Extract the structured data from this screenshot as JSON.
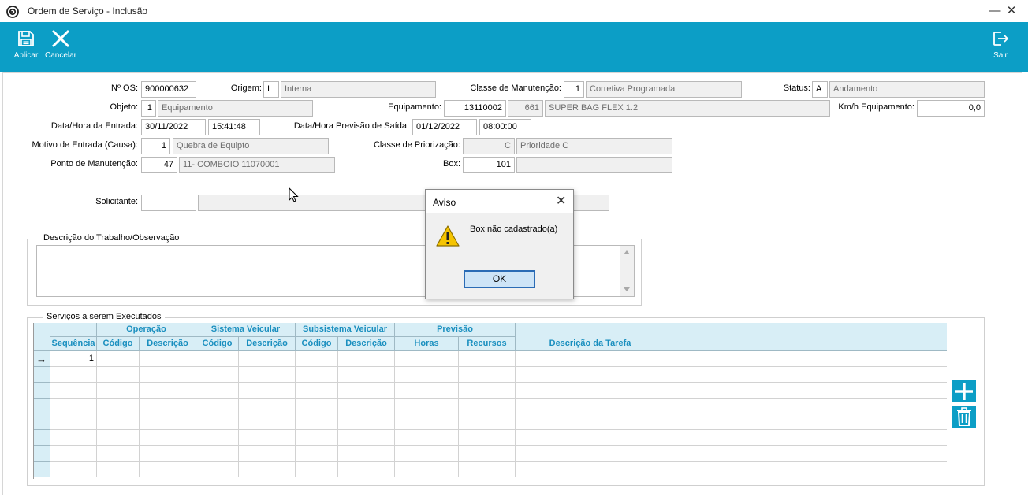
{
  "window": {
    "title": "Ordem de Serviço - Inclusão",
    "minimize": "—",
    "close": "✕"
  },
  "toolbar": {
    "apply_label": "Aplicar",
    "cancel_label": "Cancelar",
    "exit_label": "Sair",
    "bg_color": "#0c9ec6"
  },
  "form": {
    "os_number": {
      "label": "Nº OS:",
      "value": "900000632"
    },
    "origem": {
      "label": "Origem:",
      "code": "I",
      "desc": "Interna"
    },
    "classe_manutencao": {
      "label": "Classe de Manutenção:",
      "code": "1",
      "desc": "Corretiva Programada"
    },
    "status": {
      "label": "Status:",
      "code": "A",
      "desc": "Andamento"
    },
    "objeto": {
      "label": "Objeto:",
      "code": "1",
      "desc": "Equipamento"
    },
    "equipamento": {
      "label": "Equipamento:",
      "code": "13110002",
      "num": "661",
      "desc": "SUPER BAG FLEX 1.2"
    },
    "km_h": {
      "label": "Km/h Equipamento:",
      "value": "0,0"
    },
    "entrada": {
      "label": "Data/Hora da Entrada:",
      "date": "30/11/2022",
      "time": "15:41:48"
    },
    "previsao_saida": {
      "label": "Data/Hora Previsão de Saída:",
      "date": "01/12/2022",
      "time": "08:00:00"
    },
    "motivo": {
      "label": "Motivo de Entrada (Causa):",
      "code": "1",
      "desc": "Quebra de Equipto"
    },
    "priorizacao": {
      "label": "Classe de Priorização:",
      "code": "C",
      "desc": "Prioridade C"
    },
    "ponto": {
      "label": "Ponto de Manutenção:",
      "code": "47",
      "desc": "11- COMBOIO 11070001"
    },
    "box": {
      "label": "Box:",
      "code": "101",
      "desc": ""
    },
    "solicitante": {
      "label": "Solicitante:",
      "code": "",
      "desc": ""
    }
  },
  "descricao_group": {
    "title": "Descrição do Trabalho/Observação",
    "text": ""
  },
  "servicos_group": {
    "title": "Serviços a serem Executados",
    "group_headers": [
      "Operação",
      "Sistema Veicular",
      "Subsistema Veicular",
      "Previsão"
    ],
    "columns": [
      "Sequência",
      "Código",
      "Descrição",
      "Código",
      "Descrição",
      "Código",
      "Descrição",
      "Horas",
      "Recursos",
      "Descrição da Tarefa"
    ],
    "rows": [
      {
        "sequencia": "1"
      }
    ],
    "current_row_marker": "→",
    "add_icon": "plus-icon",
    "delete_icon": "trash-icon"
  },
  "dialog": {
    "title": "Aviso",
    "close": "✕",
    "message": "Box não cadastrado(a)",
    "ok_label": "OK",
    "icon": "warning-icon"
  }
}
